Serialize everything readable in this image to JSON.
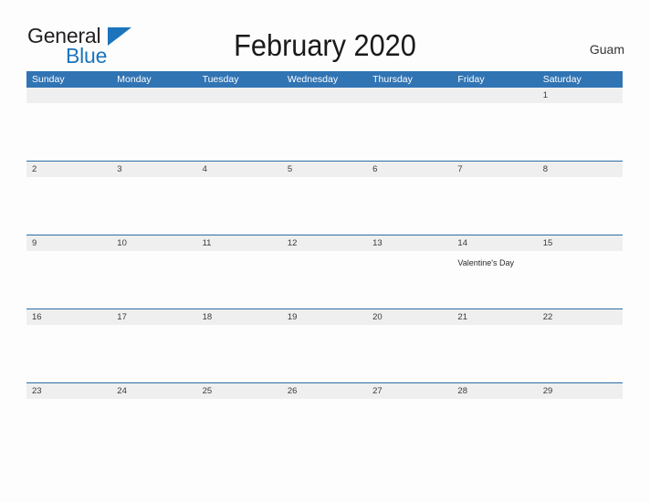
{
  "header": {
    "logo": {
      "word_dark": "General",
      "word_blue": "Blue",
      "triangle_color": "#1b74bc"
    },
    "title": "February 2020",
    "location": "Guam"
  },
  "calendar": {
    "accent_color": "#3174b4",
    "date_band_color": "#efefef",
    "weekdays": [
      "Sunday",
      "Monday",
      "Tuesday",
      "Wednesday",
      "Thursday",
      "Friday",
      "Saturday"
    ],
    "weeks": [
      {
        "dates": [
          "",
          "",
          "",
          "",
          "",
          "",
          "1"
        ],
        "events": [
          "",
          "",
          "",
          "",
          "",
          "",
          ""
        ]
      },
      {
        "dates": [
          "2",
          "3",
          "4",
          "5",
          "6",
          "7",
          "8"
        ],
        "events": [
          "",
          "",
          "",
          "",
          "",
          "",
          ""
        ]
      },
      {
        "dates": [
          "9",
          "10",
          "11",
          "12",
          "13",
          "14",
          "15"
        ],
        "events": [
          "",
          "",
          "",
          "",
          "",
          "Valentine's Day",
          ""
        ]
      },
      {
        "dates": [
          "16",
          "17",
          "18",
          "19",
          "20",
          "21",
          "22"
        ],
        "events": [
          "",
          "",
          "",
          "",
          "",
          "",
          ""
        ]
      },
      {
        "dates": [
          "23",
          "24",
          "25",
          "26",
          "27",
          "28",
          "29"
        ],
        "events": [
          "",
          "",
          "",
          "",
          "",
          "",
          ""
        ]
      }
    ]
  }
}
